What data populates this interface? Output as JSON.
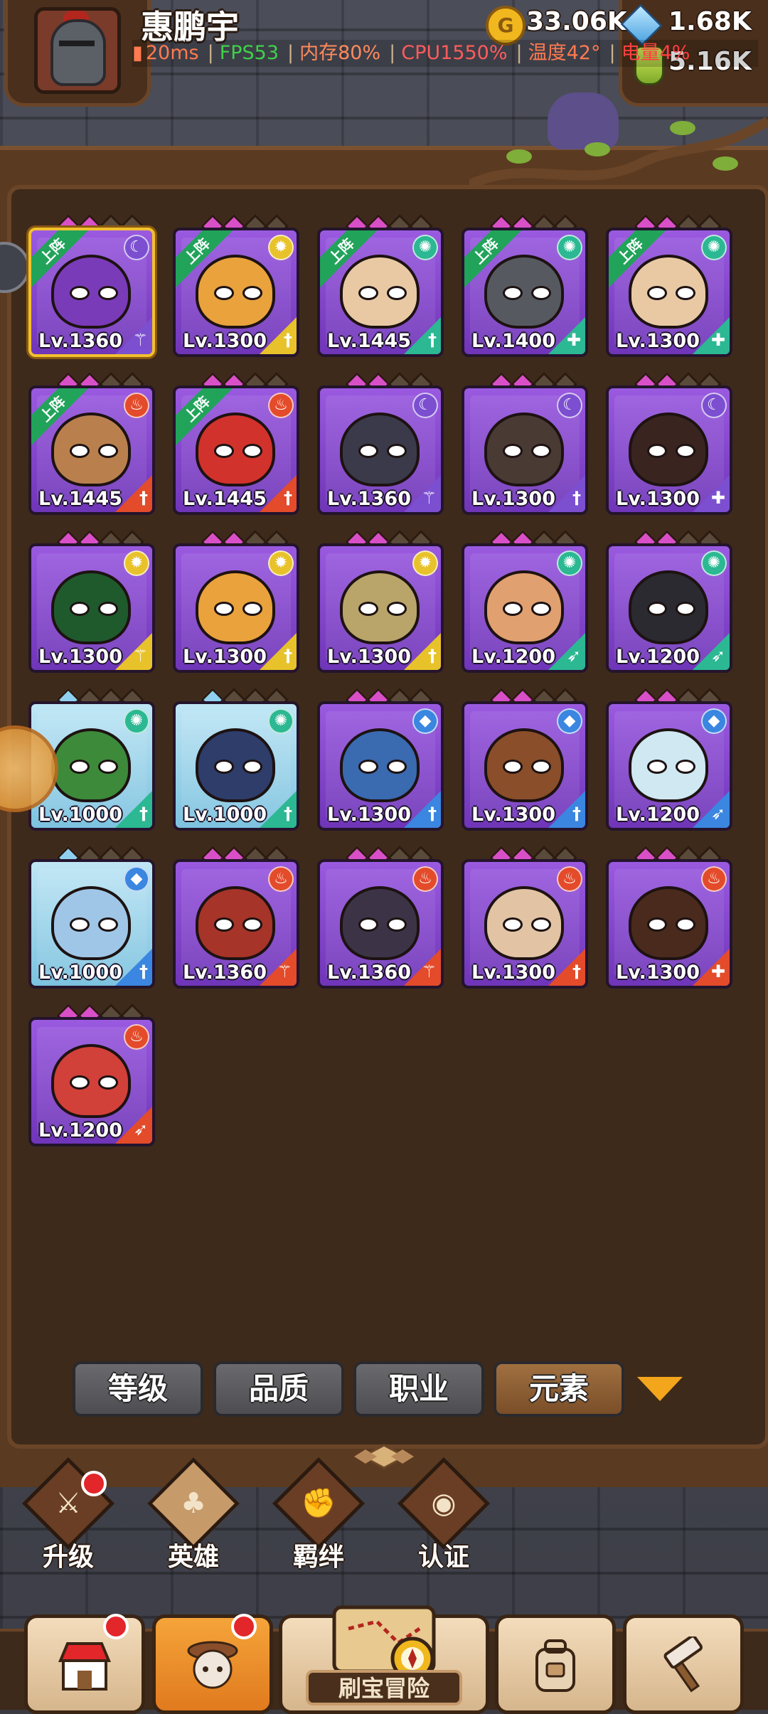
{
  "header": {
    "player_name": "惠鹏宇",
    "resources": {
      "gold": "33.06K",
      "gems": "1.68K",
      "potion": "5.16K"
    },
    "coin_glyph": "G",
    "perf": {
      "ping": "20ms",
      "fps": "FPS53",
      "memory": "内存80%",
      "cpu": "CPU1550%",
      "temperature": "温度42°",
      "battery": "电量4%"
    }
  },
  "colors": {
    "fps": "#3fd14a",
    "memory": "#ff8a5c",
    "cpu": "#ff5c5c",
    "temperature": "#ff7a50",
    "battery": "#ff4040",
    "ping": "#ff7a50",
    "fire": "#e34b2a",
    "light": "#e8c22a",
    "wind": "#2bb892",
    "water": "#3a86e0",
    "dark": "#7b4fd0"
  },
  "heroes": [
    {
      "level": "Lv.1360",
      "element": "dark",
      "frame": "purple",
      "deployed": true,
      "selected": true,
      "face": "#7a3bb8",
      "cls": "staff"
    },
    {
      "level": "Lv.1300",
      "element": "light",
      "frame": "purple",
      "deployed": true,
      "face": "#e9a23c",
      "cls": "sword"
    },
    {
      "level": "Lv.1445",
      "element": "wind",
      "frame": "purple",
      "deployed": true,
      "face": "#e9c9a4",
      "cls": "sword"
    },
    {
      "level": "Lv.1400",
      "element": "wind",
      "frame": "purple",
      "deployed": true,
      "face": "#565a60",
      "cls": "shield"
    },
    {
      "level": "Lv.1300",
      "element": "wind",
      "frame": "purple",
      "deployed": true,
      "face": "#e9c9a4",
      "cls": "shield"
    },
    {
      "level": "Lv.1445",
      "element": "fire",
      "frame": "purple",
      "deployed": true,
      "face": "#b9804e",
      "cls": "sword"
    },
    {
      "level": "Lv.1445",
      "element": "fire",
      "frame": "purple",
      "deployed": true,
      "face": "#d2322c",
      "cls": "sword"
    },
    {
      "level": "Lv.1360",
      "element": "dark",
      "frame": "purple",
      "deployed": false,
      "face": "#3a3a4a",
      "cls": "staff"
    },
    {
      "level": "Lv.1300",
      "element": "dark",
      "frame": "purple",
      "deployed": false,
      "face": "#4a3a34",
      "cls": "sword"
    },
    {
      "level": "Lv.1300",
      "element": "dark",
      "frame": "purple",
      "deployed": false,
      "face": "#3a2420",
      "cls": "shield"
    },
    {
      "level": "Lv.1300",
      "element": "light",
      "frame": "purple",
      "deployed": false,
      "face": "#1f5a2c",
      "cls": "staff"
    },
    {
      "level": "Lv.1300",
      "element": "light",
      "frame": "purple",
      "deployed": false,
      "face": "#e9a23c",
      "cls": "sword"
    },
    {
      "level": "Lv.1300",
      "element": "light",
      "frame": "purple",
      "deployed": false,
      "face": "#b9a46a",
      "cls": "sword"
    },
    {
      "level": "Lv.1200",
      "element": "wind",
      "frame": "purple",
      "deployed": false,
      "face": "#e0a070",
      "cls": "bow"
    },
    {
      "level": "Lv.1200",
      "element": "wind",
      "frame": "purple",
      "deployed": false,
      "face": "#2a2a30",
      "cls": "bow"
    },
    {
      "level": "Lv.1000",
      "element": "wind",
      "frame": "blue",
      "deployed": false,
      "face": "#3d8a3a",
      "cls": "sword"
    },
    {
      "level": "Lv.1000",
      "element": "wind",
      "frame": "blue",
      "deployed": false,
      "face": "#2e3d6a",
      "cls": "sword"
    },
    {
      "level": "Lv.1300",
      "element": "water",
      "frame": "purple",
      "deployed": false,
      "face": "#3a6ab0",
      "cls": "sword"
    },
    {
      "level": "Lv.1300",
      "element": "water",
      "frame": "purple",
      "deployed": false,
      "face": "#8a4e2a",
      "cls": "sword"
    },
    {
      "level": "Lv.1200",
      "element": "water",
      "frame": "purple",
      "deployed": false,
      "face": "#cfe8f2",
      "cls": "bow"
    },
    {
      "level": "Lv.1000",
      "element": "water",
      "frame": "blue",
      "deployed": false,
      "face": "#9fc6e6",
      "cls": "sword"
    },
    {
      "level": "Lv.1360",
      "element": "fire",
      "frame": "purple",
      "deployed": false,
      "face": "#a63428",
      "cls": "staff"
    },
    {
      "level": "Lv.1360",
      "element": "fire",
      "frame": "purple",
      "deployed": false,
      "face": "#3c3446",
      "cls": "staff"
    },
    {
      "level": "Lv.1300",
      "element": "fire",
      "frame": "purple",
      "deployed": false,
      "face": "#e2c4a4",
      "cls": "sword"
    },
    {
      "level": "Lv.1300",
      "element": "fire",
      "frame": "purple",
      "deployed": false,
      "face": "#4a2a1c",
      "cls": "shield"
    },
    {
      "level": "Lv.1200",
      "element": "fire",
      "frame": "purple",
      "deployed": false,
      "face": "#d2403a",
      "cls": "bow"
    }
  ],
  "deployed_badge": "上阵",
  "sort_buttons": [
    {
      "label": "等级",
      "active": false
    },
    {
      "label": "品质",
      "active": false
    },
    {
      "label": "职业",
      "active": false
    },
    {
      "label": "元素",
      "active": true
    }
  ],
  "sub_nav": [
    {
      "label": "升级",
      "icon": "sword-icon",
      "glyph": "⚔",
      "alert": true
    },
    {
      "label": "英雄",
      "icon": "hero-tree-icon",
      "glyph": "♣",
      "alert": false,
      "active": true
    },
    {
      "label": "羁绊",
      "icon": "handshake-icon",
      "glyph": "✊",
      "alert": false
    },
    {
      "label": "认证",
      "icon": "eye-icon",
      "glyph": "◉",
      "alert": false
    }
  ],
  "bottom_nav": [
    {
      "name": "shop",
      "icon": "shop-icon",
      "alert": true
    },
    {
      "name": "heroes",
      "icon": "hero-portrait-icon",
      "alert": true,
      "active": true
    },
    {
      "name": "adventure",
      "label": "刷宝冒险",
      "icon": "treasure-map-icon"
    },
    {
      "name": "inventory",
      "icon": "backpack-icon"
    },
    {
      "name": "forge",
      "icon": "hammer-icon"
    }
  ]
}
